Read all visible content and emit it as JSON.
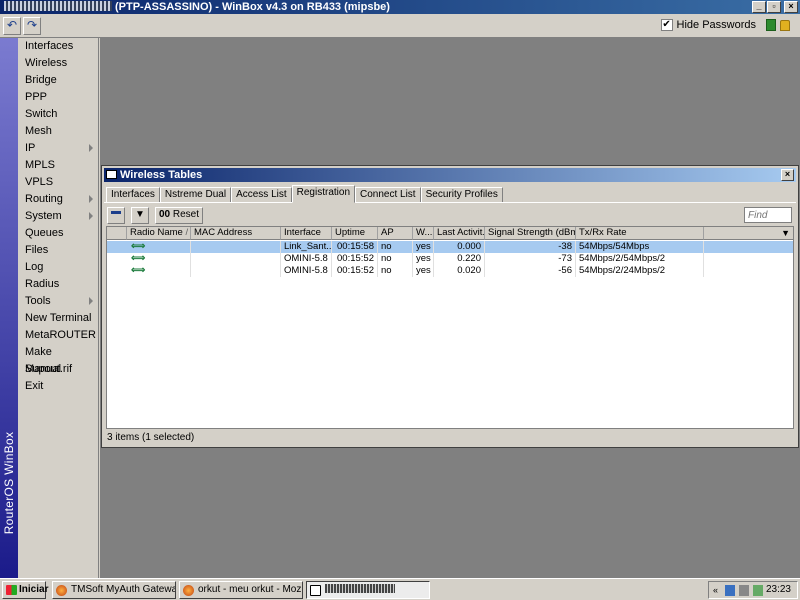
{
  "app": {
    "title": "(PTP-ASSASSINO) - WinBox v4.3 on RB433 (mipsbe)",
    "hide_passwords_label": "Hide Passwords",
    "hide_passwords_checked": "✔",
    "brand": "RouterOS WinBox"
  },
  "sidebar": {
    "items": [
      {
        "label": "Interfaces"
      },
      {
        "label": "Wireless"
      },
      {
        "label": "Bridge"
      },
      {
        "label": "PPP"
      },
      {
        "label": "Switch"
      },
      {
        "label": "Mesh"
      },
      {
        "label": "IP"
      },
      {
        "label": "MPLS"
      },
      {
        "label": "VPLS"
      },
      {
        "label": "Routing"
      },
      {
        "label": "System"
      },
      {
        "label": "Queues"
      },
      {
        "label": "Files"
      },
      {
        "label": "Log"
      },
      {
        "label": "Radius"
      },
      {
        "label": "Tools"
      },
      {
        "label": "New Terminal"
      },
      {
        "label": "MetaROUTER"
      },
      {
        "label": "Make Supout.rif"
      },
      {
        "label": "Manual"
      },
      {
        "label": "Exit"
      }
    ]
  },
  "window": {
    "title": "Wireless Tables",
    "tabs": [
      "Interfaces",
      "Nstreme Dual",
      "Access List",
      "Registration",
      "Connect List",
      "Security Profiles"
    ],
    "active_tab": "Registration",
    "reset_label": "Reset",
    "find_placeholder": "Find",
    "columns": [
      "Radio Name",
      "MAC Address",
      "Interface",
      "Uptime",
      "AP",
      "W...",
      "Last Activit...",
      "Signal Strength (dBm)",
      "Tx/Rx Rate"
    ],
    "rows": [
      {
        "radio_name": "",
        "mac": "",
        "interface": "Link_Sant...",
        "uptime": "00:15:58",
        "ap": "no",
        "w": "yes",
        "last": "0.000",
        "signal": "-38",
        "rate": "54Mbps/54Mbps",
        "selected": true
      },
      {
        "radio_name": "",
        "mac": "",
        "interface": "OMINI-5.8",
        "uptime": "00:15:52",
        "ap": "no",
        "w": "yes",
        "last": "0.220",
        "signal": "-73",
        "rate": "54Mbps/2/54Mbps/2",
        "selected": false
      },
      {
        "radio_name": "",
        "mac": "",
        "interface": "OMINI-5.8",
        "uptime": "00:15:52",
        "ap": "no",
        "w": "yes",
        "last": "0.020",
        "signal": "-56",
        "rate": "54Mbps/2/24Mbps/2",
        "selected": false
      }
    ],
    "status": "3 items (1 selected)"
  },
  "taskbar": {
    "start_label": "Iniciar",
    "tasks": [
      {
        "label": "TMSoft MyAuth Gateway..."
      },
      {
        "label": "orkut - meu orkut - Mozill..."
      }
    ],
    "clock": "23:23"
  },
  "colors": {
    "titlebar": "#0a246a",
    "selection": "#a6caf0",
    "workspace": "#808080",
    "face": "#d4d0c8"
  }
}
